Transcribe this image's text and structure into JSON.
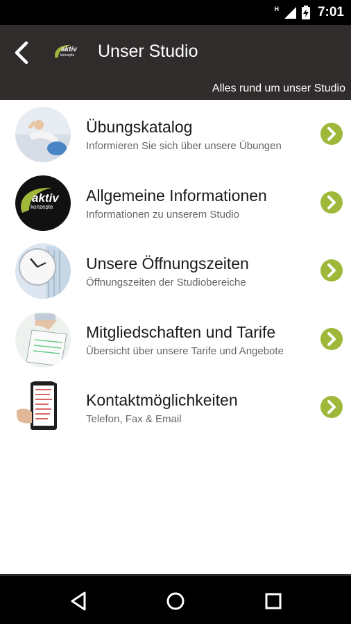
{
  "status": {
    "time": "7:01",
    "network": "H"
  },
  "appbar": {
    "title": "Unser Studio",
    "subtitle": "Alles rund um unser Studio",
    "logo_text_top": "aktiv",
    "logo_text_bottom": "konzepte"
  },
  "menu": [
    {
      "title": "Übungskatalog",
      "subtitle": "Informieren Sie sich über unsere Übungen",
      "icon": "fitness-photo"
    },
    {
      "title": "Allgemeine Informationen",
      "subtitle": "Informationen zu unserem Studio",
      "icon": "aktiv-konzepte-logo",
      "logo_top": "aktiv",
      "logo_bottom": "konzepte"
    },
    {
      "title": "Unsere Öffnungszeiten",
      "subtitle": "Öffnungszeiten der Studiobereiche",
      "icon": "clock-photo"
    },
    {
      "title": "Mitgliedschaften und Tarife",
      "subtitle": "Übersicht über unsere Tarife und Angebote",
      "icon": "contract-photo"
    },
    {
      "title": "Kontaktmöglichkeiten",
      "subtitle": "Telefon, Fax & Email",
      "icon": "contact-phone-photo"
    }
  ],
  "colors": {
    "appbar": "#2f2c2b",
    "accent": "#9fb83a",
    "statusbar": "#000000"
  }
}
